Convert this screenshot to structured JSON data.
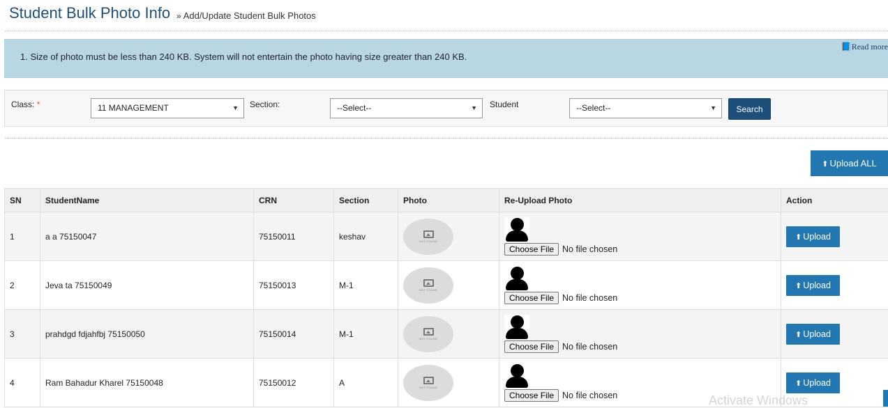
{
  "header": {
    "title": "Student Bulk Photo Info",
    "breadcrumb_sep": "»",
    "breadcrumb": "Add/Update Student Bulk Photos"
  },
  "info": {
    "text": "1. Size of photo must be less than 240 KB. System will not entertain the photo having size greater than 240 KB.",
    "read_more": "Read more"
  },
  "filters": {
    "class_label": "Class:",
    "required_mark": "*",
    "class_value": "11 MANAGEMENT",
    "section_label": "Section:",
    "section_value": "--Select--",
    "student_label": "Student",
    "student_value": "--Select--",
    "search_label": "Search"
  },
  "upload_all_label": "Upload ALL",
  "table": {
    "headers": [
      "SN",
      "StudentName",
      "CRN",
      "Section",
      "Photo",
      "Re-Upload Photo",
      "Action"
    ],
    "rows": [
      {
        "sn": "1",
        "name": "a a 75150047",
        "crn": "75150011",
        "section": "keshav",
        "file_btn": "Choose File",
        "file_status": "No file chosen",
        "photo_text": "NOT FOUND",
        "action": "Upload"
      },
      {
        "sn": "2",
        "name": "Jeva ta 75150049",
        "crn": "75150013",
        "section": "M-1",
        "file_btn": "Choose File",
        "file_status": "No file chosen",
        "photo_text": "NOT FOUND",
        "action": "Upload"
      },
      {
        "sn": "3",
        "name": "prahdgd fdjahfbj 75150050",
        "crn": "75150014",
        "section": "M-1",
        "file_btn": "Choose File",
        "file_status": "No file chosen",
        "photo_text": "NOT FOUND",
        "action": "Upload"
      },
      {
        "sn": "4",
        "name": "Ram Bahadur Kharel 75150048",
        "crn": "75150012",
        "section": "A",
        "file_btn": "Choose File",
        "file_status": "No file chosen",
        "photo_text": "NOT FOUND",
        "action": "Upload"
      }
    ]
  },
  "watermark": "Activate Windows",
  "icons": {
    "breadcrumb": "double-chevron-right-icon",
    "read_more": "book-icon",
    "upload": "upload-icon",
    "select": "caret-down-icon",
    "avatar": "user-silhouette-icon",
    "photo": "image-not-found-icon"
  },
  "colors": {
    "title": "#1f4e79",
    "info_bg": "#b9d7e3",
    "search_btn": "#1d4f7a",
    "upload_btn": "#2277b0",
    "required": "#d9534f"
  }
}
